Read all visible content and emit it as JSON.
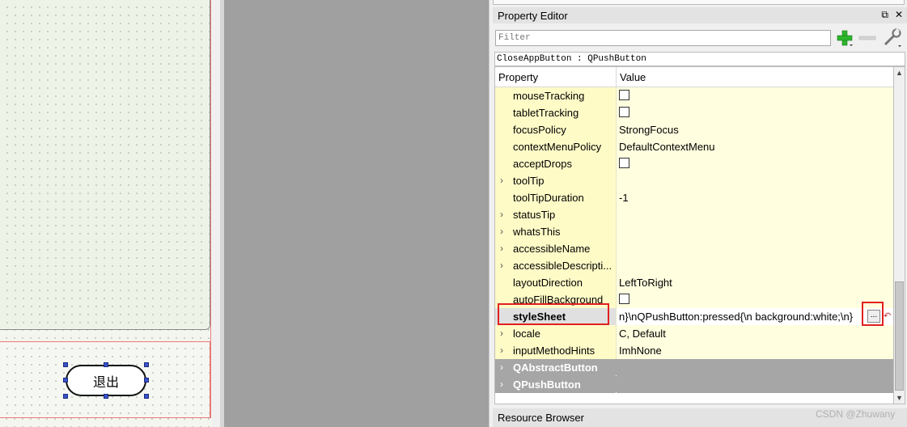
{
  "form": {
    "exit_button_label": "退出"
  },
  "property_editor": {
    "title": "Property Editor",
    "float_glyph": "⧉",
    "close_glyph": "✕",
    "filter_placeholder": "Filter",
    "object_label": "CloseAppButton : QPushButton",
    "columns": {
      "property": "Property",
      "value": "Value"
    },
    "rows": [
      {
        "name": "mouseTracking",
        "type": "checkbox",
        "value": ""
      },
      {
        "name": "tabletTracking",
        "type": "checkbox",
        "value": ""
      },
      {
        "name": "focusPolicy",
        "type": "text",
        "value": "StrongFocus"
      },
      {
        "name": "contextMenuPolicy",
        "type": "text",
        "value": "DefaultContextMenu"
      },
      {
        "name": "acceptDrops",
        "type": "checkbox",
        "value": ""
      },
      {
        "name": "toolTip",
        "type": "expandable",
        "value": ""
      },
      {
        "name": "toolTipDuration",
        "type": "text",
        "value": "-1"
      },
      {
        "name": "statusTip",
        "type": "expandable",
        "value": ""
      },
      {
        "name": "whatsThis",
        "type": "expandable",
        "value": ""
      },
      {
        "name": "accessibleName",
        "type": "expandable",
        "value": ""
      },
      {
        "name": "accessibleDescripti...",
        "type": "expandable",
        "value": ""
      },
      {
        "name": "layoutDirection",
        "type": "text",
        "value": "LeftToRight"
      },
      {
        "name": "autoFillBackground",
        "type": "checkbox",
        "value": ""
      },
      {
        "name": "styleSheet",
        "type": "stylesheet",
        "value": "n}\\nQPushButton:pressed{\\n    background:white;\\n}"
      },
      {
        "name": "locale",
        "type": "expandable",
        "value": "C, Default"
      },
      {
        "name": "inputMethodHints",
        "type": "expandable",
        "value": "ImhNone"
      }
    ],
    "groups": [
      "QAbstractButton",
      "QPushButton"
    ],
    "ellipsis_label": "...",
    "reset_glyph": "↶"
  },
  "resource_browser": {
    "title": "Resource Browser"
  },
  "watermark": "CSDN @Zhuwany",
  "colors": {
    "highlight_red": "#e02020",
    "row_name_bg": "#fffbc7",
    "row_value_bg": "#fffedf",
    "group_bg": "#a6a6a6",
    "plus_green": "#2db52d"
  }
}
